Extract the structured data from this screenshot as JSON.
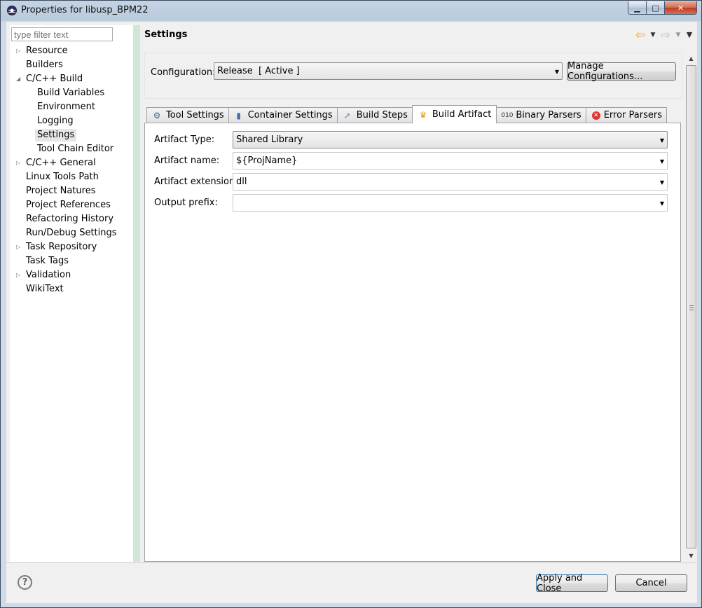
{
  "window": {
    "title": "Properties for libusp_BPM22"
  },
  "sidebar": {
    "filter_placeholder": "type filter text",
    "items": [
      {
        "label": "Resource",
        "level": 0,
        "expander": "collapsed"
      },
      {
        "label": "Builders",
        "level": 0,
        "expander": "none"
      },
      {
        "label": "C/C++ Build",
        "level": 0,
        "expander": "expanded"
      },
      {
        "label": "Build Variables",
        "level": 1
      },
      {
        "label": "Environment",
        "level": 1
      },
      {
        "label": "Logging",
        "level": 1
      },
      {
        "label": "Settings",
        "level": 1,
        "selected": true
      },
      {
        "label": "Tool Chain Editor",
        "level": 1
      },
      {
        "label": "C/C++ General",
        "level": 0,
        "expander": "collapsed"
      },
      {
        "label": "Linux Tools Path",
        "level": 0,
        "expander": "none"
      },
      {
        "label": "Project Natures",
        "level": 0,
        "expander": "none"
      },
      {
        "label": "Project References",
        "level": 0,
        "expander": "none"
      },
      {
        "label": "Refactoring History",
        "level": 0,
        "expander": "none"
      },
      {
        "label": "Run/Debug Settings",
        "level": 0,
        "expander": "none"
      },
      {
        "label": "Task Repository",
        "level": 0,
        "expander": "collapsed"
      },
      {
        "label": "Task Tags",
        "level": 0,
        "expander": "none"
      },
      {
        "label": "Validation",
        "level": 0,
        "expander": "collapsed"
      },
      {
        "label": "WikiText",
        "level": 0,
        "expander": "none"
      }
    ]
  },
  "header": {
    "title": "Settings"
  },
  "configuration": {
    "label": "Configuration:",
    "value": "Release  [ Active ]",
    "manage_button": "Manage Configurations..."
  },
  "tabs": [
    {
      "label": "Tool Settings",
      "icon": "tool-settings-icon"
    },
    {
      "label": "Container Settings",
      "icon": "container-icon"
    },
    {
      "label": "Build Steps",
      "icon": "build-steps-icon"
    },
    {
      "label": "Build Artifact",
      "icon": "trophy-icon",
      "active": true
    },
    {
      "label": "Binary Parsers",
      "icon": "binary-icon"
    },
    {
      "label": "Error Parsers",
      "icon": "error-icon"
    }
  ],
  "artifact": {
    "type_label": "Artifact Type:",
    "type_value": "Shared Library",
    "name_label": "Artifact name:",
    "name_value": "${ProjName}",
    "extension_label": "Artifact extension:",
    "extension_value": "dll",
    "prefix_label": "Output prefix:",
    "prefix_value": ""
  },
  "footer": {
    "help_glyph": "?",
    "apply_button": "Apply and Close",
    "cancel_button": "Cancel"
  },
  "colors": {
    "sidebar_scroll": "#cfe7d4",
    "error_icon": "#dd3333",
    "back_arrow": "#e0a020"
  }
}
